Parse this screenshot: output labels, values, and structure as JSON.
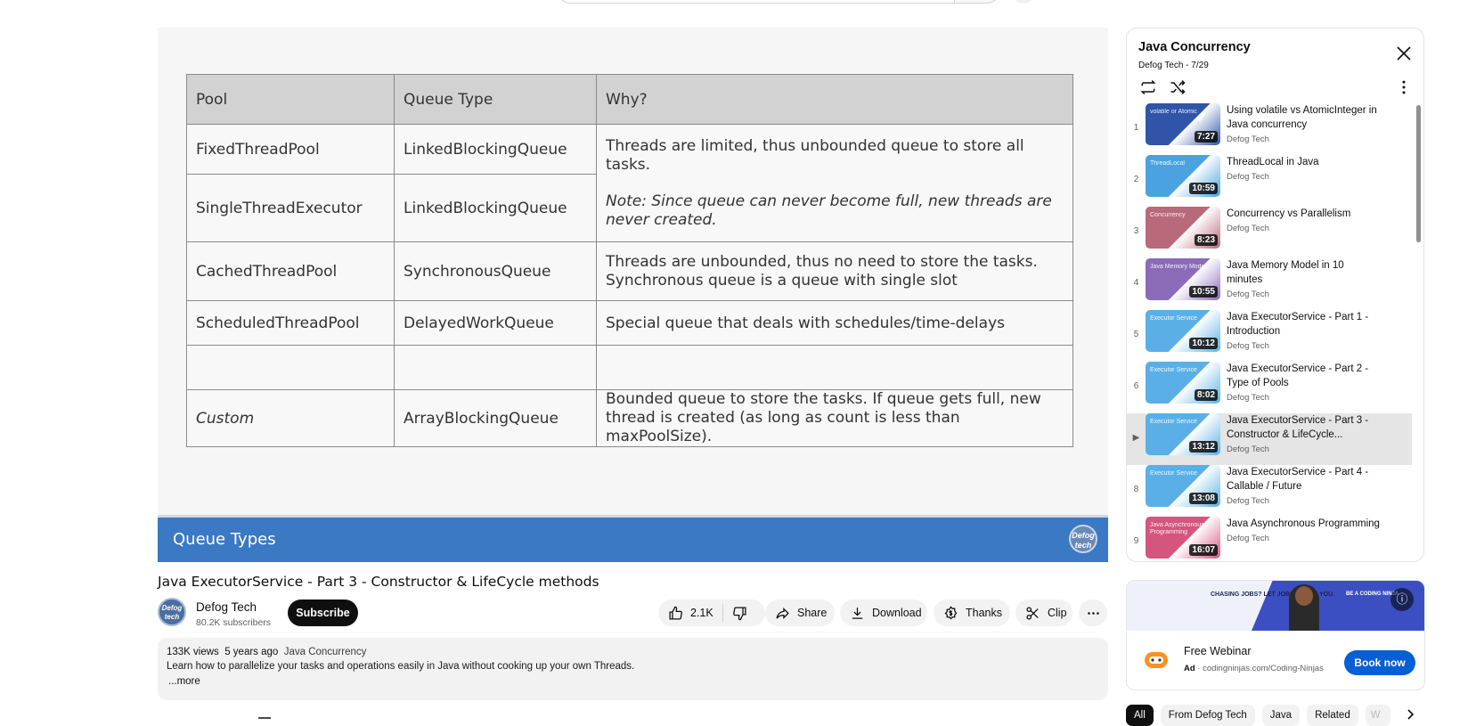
{
  "slide": {
    "headers": [
      "Pool",
      "Queue Type",
      "Why?"
    ],
    "rows": [
      {
        "pool": "FixedThreadPool",
        "queue": "LinkedBlockingQueue"
      },
      {
        "pool": "SingleThreadExecutor",
        "queue": "LinkedBlockingQueue"
      },
      {
        "pool": "CachedThreadPool",
        "queue": "SynchronousQueue",
        "why": "Threads are unbounded, thus no need to store the tasks. Synchronous queue is a queue with single slot"
      },
      {
        "pool": "ScheduledThreadPool",
        "queue": "DelayedWorkQueue",
        "why": "Special queue that deals with schedules/time-delays"
      },
      {
        "pool": "",
        "queue": "",
        "why": ""
      },
      {
        "pool": "Custom",
        "queue": "ArrayBlockingQueue",
        "why": "Bounded queue to store the tasks. If queue gets full, new thread is created (as long as count is less than maxPoolSize)."
      }
    ],
    "merged_why": "Threads are limited, thus unbounded queue to store all tasks.",
    "merged_note": "Note: Since queue can never become full, new threads are never created.",
    "footer_title": "Queue Types",
    "logo_text": "Defog tech"
  },
  "video": {
    "title": "Java ExecutorService - Part 3 - Constructor & LifeCycle methods",
    "channel": "Defog Tech",
    "subscribers": "80.2K subscribers",
    "avatar_text": "Defog tech",
    "subscribe_label": "Subscribe",
    "likes": "2.1K",
    "share_label": "Share",
    "download_label": "Download",
    "thanks_label": "Thanks",
    "clip_label": "Clip"
  },
  "description": {
    "views": "133K views",
    "age": "5 years ago",
    "playlist": "Java Concurrency",
    "text": "Learn how to parallelize your tasks and operations easily in Java without cooking up your own Threads.",
    "more": "...more"
  },
  "playlist": {
    "title": "Java Concurrency",
    "subtitle": "Defog Tech - 7/29",
    "items": [
      {
        "index": "1",
        "title": "Using volatile vs AtomicInteger in Java concurrency",
        "channel": "Defog Tech",
        "duration": "7:27",
        "thumb_color": "#2f54a8",
        "caption": "volatile or Atomic"
      },
      {
        "index": "2",
        "title": "ThreadLocal in Java",
        "channel": "Defog Tech",
        "duration": "10:59",
        "thumb_color": "#4aa3df",
        "caption": "ThreadLocal"
      },
      {
        "index": "3",
        "title": "Concurrency vs Parallelism",
        "channel": "Defog Tech",
        "duration": "8:23",
        "thumb_color": "#b86a7a",
        "caption": "Concurrency"
      },
      {
        "index": "4",
        "title": "Java Memory Model in 10 minutes",
        "channel": "Defog Tech",
        "duration": "10:55",
        "thumb_color": "#8a6bb8",
        "caption": "Java Memory Model"
      },
      {
        "index": "5",
        "title": "Java ExecutorService - Part 1 - Introduction",
        "channel": "Defog Tech",
        "duration": "10:12",
        "thumb_color": "#5ab0e6",
        "caption": "Executor Service"
      },
      {
        "index": "6",
        "title": "Java ExecutorService - Part 2 - Type of Pools",
        "channel": "Defog Tech",
        "duration": "8:02",
        "thumb_color": "#5ab0e6",
        "caption": "Executor Service"
      },
      {
        "index": "▶",
        "title": "Java ExecutorService - Part 3 - Constructor & LifeCycle...",
        "channel": "Defog Tech",
        "duration": "13:12",
        "thumb_color": "#5ab0e6",
        "caption": "Executor Service",
        "active": true
      },
      {
        "index": "8",
        "title": "Java ExecutorService - Part 4 - Callable / Future",
        "channel": "Defog Tech",
        "duration": "13:08",
        "thumb_color": "#5ab0e6",
        "caption": "Executor Service"
      },
      {
        "index": "9",
        "title": "Java Asynchronous Programming",
        "channel": "Defog Tech",
        "duration": "16:07",
        "thumb_color": "#d4557e",
        "caption": "Java Asynchronous Programming"
      }
    ]
  },
  "ad": {
    "banner_left": "CHASING JOBS? LET JOBS CHASE YOU.",
    "banner_right": "BE A CODING NINJA",
    "title": "Free Webinar",
    "ad_label": "Ad",
    "url": "codingninjas.com/Coding-Ninjas",
    "button": "Book now"
  },
  "chips": [
    "All",
    "From Defog Tech",
    "Java",
    "Related",
    "W"
  ],
  "colors": {
    "slide_footer": "#3b79c4",
    "subscribe_bg": "#0f0f0f",
    "ad_button": "#065fd4",
    "active_row": "#e5e5e5"
  }
}
